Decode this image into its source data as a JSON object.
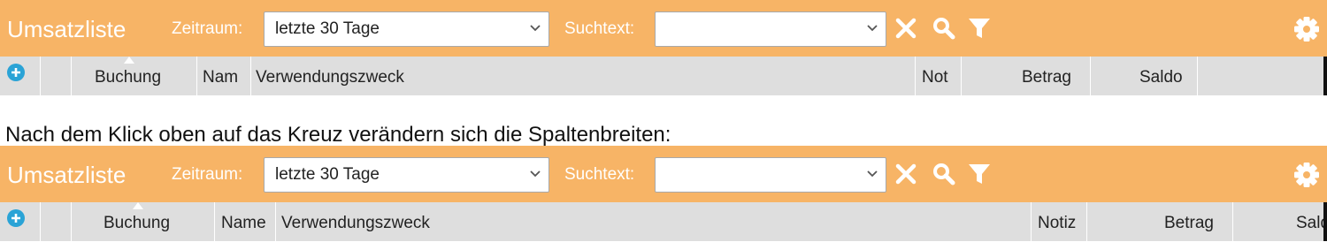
{
  "panels": [
    {
      "title": "Umsatzliste",
      "zeitraum_label": "Zeitraum:",
      "zeitraum_value": "letzte 30 Tage",
      "suchtext_label": "Suchtext:",
      "suchtext_value": "",
      "columns": [
        "Buchung",
        "Nam",
        "Verwendungszweck",
        "Not",
        "Betrag",
        "Saldo"
      ]
    },
    {
      "title": "Umsatzliste",
      "zeitraum_label": "Zeitraum:",
      "zeitraum_value": "letzte 30 Tage",
      "suchtext_label": "Suchtext:",
      "suchtext_value": "",
      "columns": [
        "Buchung",
        "Name",
        "Verwendungszweck",
        "Notiz",
        "Betrag",
        "Saldo"
      ]
    }
  ],
  "caption": "Nach dem Klick oben auf das Kreuz verändern sich die Spaltenbreiten:",
  "icons": [
    "add-icon",
    "sort-ascending-icon",
    "chevron-down-icon",
    "close-icon",
    "search-icon",
    "filter-icon",
    "gear-icon"
  ],
  "colors": {
    "toolbar": "#f7b466",
    "header": "#dedede",
    "add": "#2aa3d6"
  }
}
